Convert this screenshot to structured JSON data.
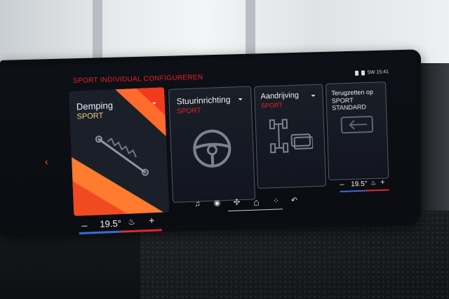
{
  "header": {
    "title": "SPORT INDIVIDUAL CONFIGUREREN"
  },
  "status_bar": {
    "text": "5W  15:41"
  },
  "cards": [
    {
      "name": "Demping",
      "value": "SPORT",
      "icon": "shock-absorber-icon"
    },
    {
      "name": "Stuurinrichting",
      "value": "SPORT",
      "icon": "steering-wheel-icon"
    },
    {
      "name": "Aandrijving",
      "value": "SPORT",
      "icon": "drivetrain-icon"
    },
    {
      "name": "Terugzetten op",
      "value": "SPORT STANDARD",
      "icon": "reset-icon"
    }
  ],
  "climate": {
    "left": {
      "temp": "19.5°",
      "minus": "–",
      "plus": "+"
    },
    "right": {
      "temp": "19.5°",
      "minus": "–",
      "plus": "+"
    }
  },
  "navbar": {
    "icons": [
      "music-icon",
      "media-icon",
      "fan-icon",
      "home-icon",
      "apps-icon",
      "back-icon"
    ],
    "glyphs": {
      "music": "♫",
      "media": "◉",
      "fan": "✣",
      "home": "⌂",
      "apps": "⁘",
      "back": "↶"
    }
  },
  "glyphs": {
    "back_arrow": "‹",
    "seat": "♨"
  },
  "colors": {
    "accent_red": "#e8202a",
    "orange": "#ff6b2d",
    "sport_yellow": "#e9d27a"
  }
}
